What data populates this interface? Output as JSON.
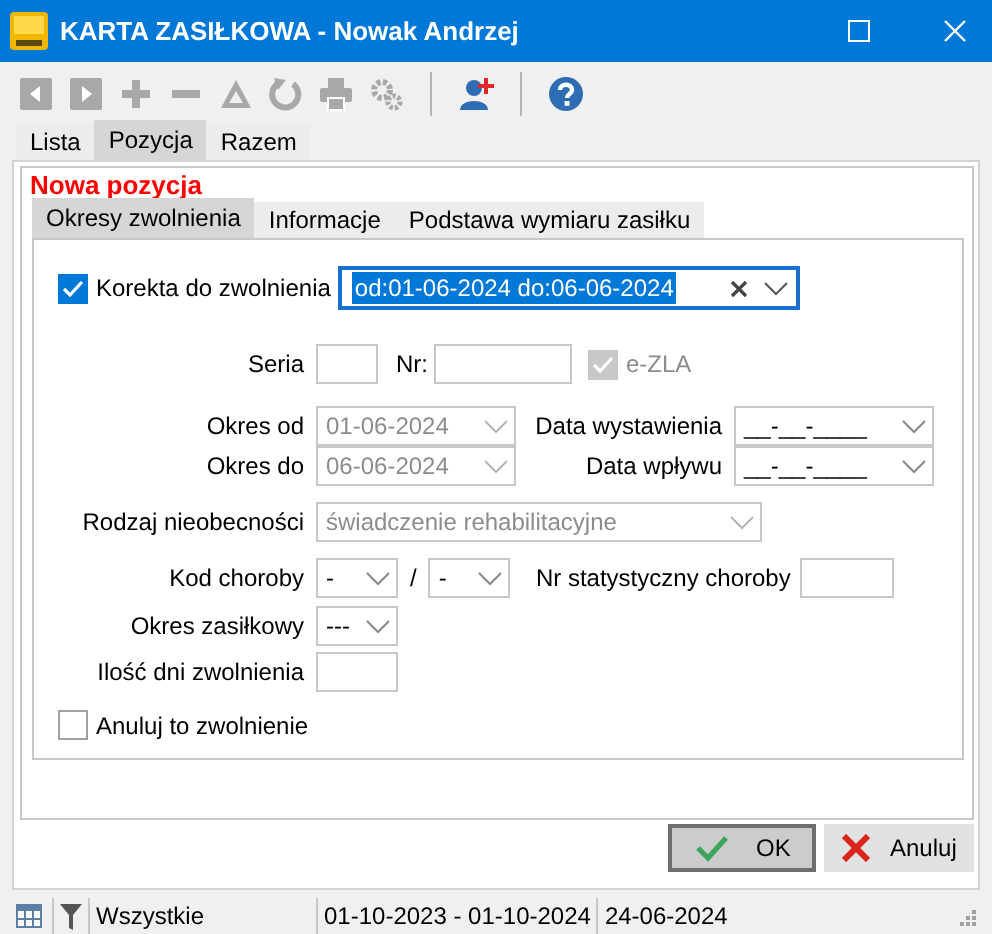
{
  "window": {
    "title": "KARTA ZASIŁKOWA - Nowak Andrzej"
  },
  "toolbar": [
    {
      "kind": "previous",
      "disabled": true
    },
    {
      "kind": "next",
      "disabled": true
    },
    {
      "kind": "add",
      "disabled": true
    },
    {
      "kind": "remove",
      "disabled": true
    },
    {
      "kind": "triangle",
      "disabled": true
    },
    {
      "kind": "refresh",
      "disabled": true
    },
    {
      "kind": "print",
      "disabled": true
    },
    {
      "kind": "settings",
      "disabled": true
    },
    {
      "kind": "separator"
    },
    {
      "kind": "add-user",
      "disabled": false
    },
    {
      "kind": "separator"
    },
    {
      "kind": "help",
      "disabled": false
    }
  ],
  "tabs": [
    {
      "label": "Lista",
      "selected": false
    },
    {
      "label": "Pozycja",
      "selected": true
    },
    {
      "label": "Razem",
      "selected": false
    }
  ],
  "section_title": "Nowa pozycja",
  "subtabs": [
    {
      "label": "Okresy zwolnienia",
      "selected": true
    },
    {
      "label": "Informacje",
      "selected": false
    },
    {
      "label": "Podstawa wymiaru zasiłku",
      "selected": false
    }
  ],
  "correction": {
    "label": "Korekta do zwolnienia",
    "checked": true,
    "value": "od:01-06-2024 do:06-06-2024"
  },
  "seria": {
    "label": "Seria"
  },
  "nr": {
    "label": "Nr:"
  },
  "ezla": {
    "label": "e-ZLA",
    "checked": true,
    "disabled": true
  },
  "okres_od": {
    "label": "Okres od",
    "value": "01-06-2024",
    "disabled": true
  },
  "data_wystawienia": {
    "label": "Data wystawienia",
    "value": "__-__-____",
    "disabled": false
  },
  "okres_do": {
    "label": "Okres do",
    "value": "06-06-2024",
    "disabled": true
  },
  "data_wplywu": {
    "label": "Data wpływu",
    "value": "__-__-____",
    "disabled": false
  },
  "rodzaj": {
    "label": "Rodzaj nieobecności",
    "value": "świadczenie rehabilitacyjne",
    "disabled": true
  },
  "kod_choroby": {
    "label": "Kod choroby",
    "values": [
      "-",
      "-"
    ],
    "separator": "/"
  },
  "nr_statystyczny": {
    "label": "Nr statystyczny choroby"
  },
  "okres_zasilkowy": {
    "label": "Okres zasiłkowy",
    "value": "---"
  },
  "ilosc_dni": {
    "label": "Ilość dni zwolnienia"
  },
  "anuluj_zwolnienie": {
    "label": "Anuluj to zwolnienie",
    "checked": false
  },
  "buttons": [
    {
      "label": "OK",
      "kind": "ok",
      "default": true
    },
    {
      "label": "Anuluj",
      "kind": "cancel",
      "default": false
    }
  ],
  "status_bar": {
    "filter": "Wszystkie",
    "period": "01-10-2023 - 01-10-2024",
    "date": "24-06-2024"
  }
}
